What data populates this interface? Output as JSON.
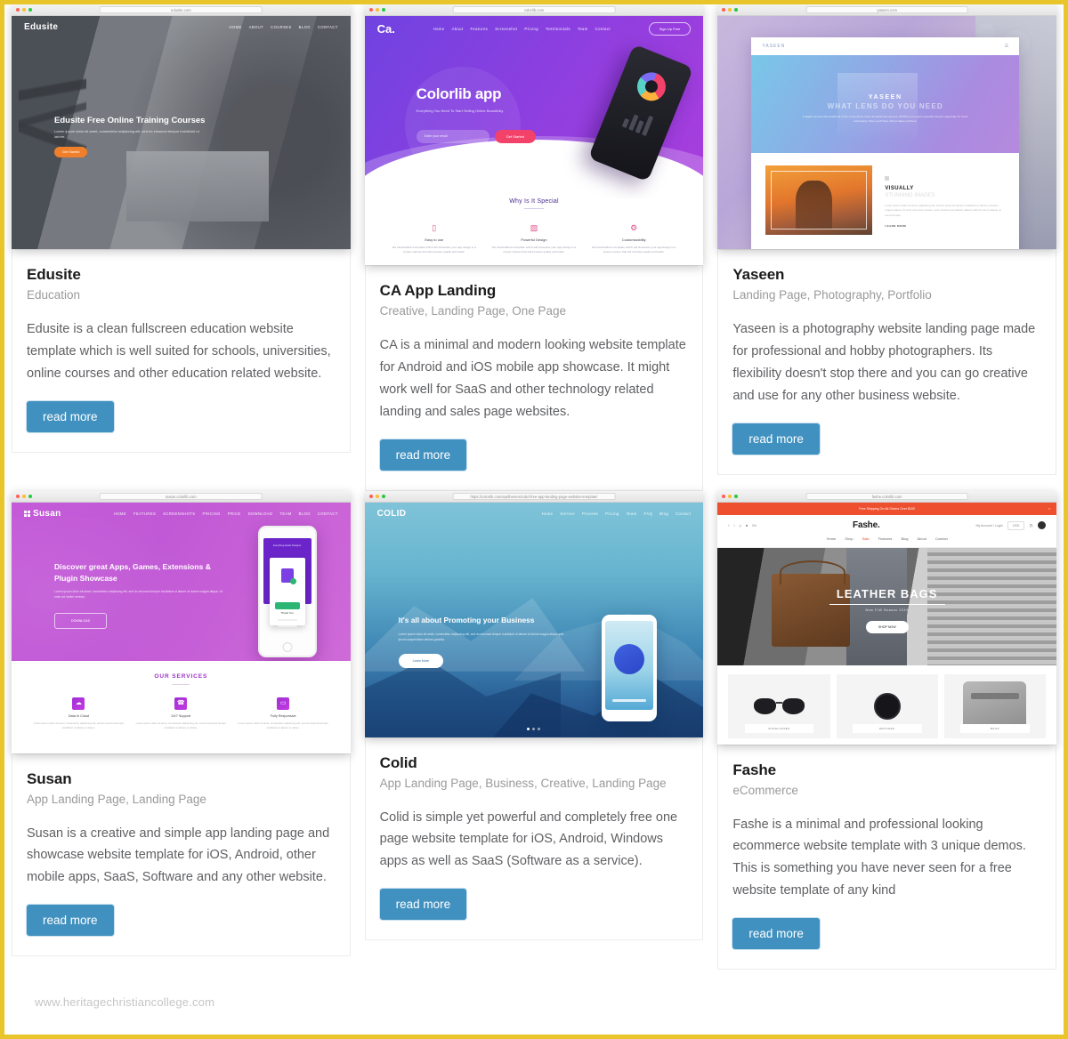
{
  "theme": {
    "page_border_color": "#e8c52a",
    "button_color": "#4191c0",
    "title_color": "#1b1b1b",
    "category_color": "#9a9a9a",
    "description_color": "#5f6063"
  },
  "watermark": "www.heritagechristiancollege.com",
  "cards": [
    {
      "title": "Edusite",
      "categories": "Education",
      "description": "Edusite is a clean fullscreen education website template which is well suited for schools, universities, online courses and other education related website.",
      "button_label": "read more",
      "preview": {
        "url": "edusite.com",
        "logo": "Edusite",
        "nav": [
          "HOME",
          "ABOUT",
          "COURSES",
          "BLOG",
          "CONTACT"
        ],
        "hero_title": "Edusite Free Online Training Courses",
        "hero_sub": "Lorem ipsum dolor sit amet, consectetur adipiscing elit, sed do eiusmod tempor incididunt ut labore.",
        "cta": "Get Started"
      }
    },
    {
      "title": "CA App Landing",
      "categories": "Creative, Landing Page, One Page",
      "description": "CA is a minimal and modern looking website template for Android and iOS mobile app showcase. It might work well for SaaS and other technology related landing and sales page websites.",
      "button_label": "read more",
      "preview": {
        "url": "colorlib.com",
        "logo": "Ca.",
        "nav": [
          "Home",
          "About",
          "Features",
          "Screenshot",
          "Pricing",
          "Testimonials",
          "Team",
          "Contact"
        ],
        "signup_label": "Sign Up Free",
        "hero_title": "Colorlib app",
        "hero_sub": "Everything You Need To Start Selling Online Beautifully.",
        "email_placeholder": "Enter your email",
        "cta": "Get Started",
        "section_title": "Why Is It Special",
        "features": [
          {
            "icon": "mobile-icon",
            "glyph": "▯",
            "title": "Easy to use",
            "text": "We handcrafted a template which will showcase your app design in a proper manner that will increase quality and leads."
          },
          {
            "icon": "layers-icon",
            "glyph": "▧",
            "title": "Powerful Design",
            "text": "We handcrafted a template which will showcase your app design in a proper manner that will increase quality and leads."
          },
          {
            "icon": "gear-icon",
            "glyph": "⚙",
            "title": "Customizability",
            "text": "We handcrafted a template which will showcase your app design in a proper manner that will increase quality and leads."
          }
        ]
      }
    },
    {
      "title": "Yaseen",
      "categories": "Landing Page, Photography, Portfolio",
      "description": "Yaseen is a photography website landing page made for professional and hobby photographers. Its flexibility doesn't stop there and you can go creative and use for any other business website.",
      "button_label": "read more",
      "preview": {
        "url": "yaseen.com",
        "logo": "YASEEN",
        "menu_icon": "hamburger-icon",
        "banner_title": "YASEEN",
        "banner_subtitle": "WHAT LENS DO YOU NEED",
        "banner_text": "A digital camera that breaks all of the conventions of an old fashioned camera. Whether you need a specific camera especially for focus and beauty, there you'll have what it takes out there.",
        "section_title": "VISUALLY",
        "section_subtitle": "STUNNING IMAGES",
        "section_text": "Lorem ipsum dolor sit amet, adipiscing elit, sed do eiusmod tempor incididunt ut labore et dolore magna aliqua. Ut enim ad minim veniam, quis nostrud exercitation ullamco laboris nisi ut aliquip ex ea commodo.",
        "read_more": "LEARN MORE"
      }
    },
    {
      "title": "Susan",
      "categories": "App Landing Page, Landing Page",
      "description": "Susan is a creative and simple app landing page and showcase website template for iOS, Android, other mobile apps, SaaS, Software and any other website.",
      "button_label": "read more",
      "preview": {
        "url": "susan.colorlib.com",
        "logo": "Susan",
        "nav": [
          "HOME",
          "FEATURES",
          "SCREENSHOTS",
          "PRICING",
          "PRICE",
          "DOWNLOAD",
          "TEAM",
          "BLOG",
          "CONTACT"
        ],
        "hero_title": "Discover great Apps, Games, Extensions & Plugin Showcase",
        "hero_sub": "Lorem ipsum dolor sit amet, consectetur adipiscing elit, sed do eiusmod tempor incididunt ut labore et dolore magna aliqua. Ut enim ad minim veniam.",
        "download_label": "DOWNLOAD",
        "phone_headline": "Everything Awaits Designer",
        "phone_thanks": "Thank You",
        "phone_note": "Your order has been placed successfully",
        "phone_cta": "CONTINUE SHOPPING",
        "section_title": "OUR SERVICES",
        "features": [
          {
            "icon": "cloud-icon",
            "glyph": "☁",
            "title": "Data In Cloud",
            "text": "Lorem ipsum dolor sit amet, consectetur adipiscing elit, sed do eiusmod tempor incididunt ut labore et dolore."
          },
          {
            "icon": "support-icon",
            "glyph": "☎",
            "title": "24/7 Support",
            "text": "Lorem ipsum dolor sit amet, consectetur adipiscing elit, sed do eiusmod tempor incididunt ut labore et dolore."
          },
          {
            "icon": "responsive-icon",
            "glyph": "▭",
            "title": "Fully Responsive",
            "text": "Lorem ipsum dolor sit amet, consectetur adipiscing elit, sed do eiusmod tempor incididunt ut labore et dolore."
          }
        ]
      }
    },
    {
      "title": "Colid",
      "categories": "App Landing Page, Business, Creative, Landing Page",
      "description": "Colid is simple yet powerful and completely free one page website template for iOS, Android, Windows apps as well as SaaS (Software as a service).",
      "button_label": "read more",
      "preview": {
        "url": "https://colorlib.com/wp/themes/colid-free-app-landing-page-website-template/",
        "logo": "COLID",
        "nav": [
          "Home",
          "Service",
          "Process",
          "Pricing",
          "Team",
          "FAQ",
          "Blog",
          "Contact"
        ],
        "hero_title": "It's all about Promoting your Business",
        "hero_sub": "Lorem ipsum dolor sit amet, consectetur adipiscing elit, sed do eiusmod tempor incididunt ut labore et dolore magna aliqua quis ipsum suspendisse ultrices gravida.",
        "cta": "Learn More"
      }
    },
    {
      "title": "Fashe",
      "categories": "eCommerce",
      "description": "Fashe is a minimal and professional looking ecommerce website template with 3 unique demos. This is something you have never seen for a free website template of any kind",
      "button_label": "read more",
      "preview": {
        "url": "fashe.colorlib.com",
        "promo_text": "Free Shipping On All Orders Over $100",
        "promo_close": "×",
        "brand": "Fashe.",
        "social_icons": [
          "facebook-icon",
          "twitter-icon",
          "pinterest-icon",
          "instagram-icon",
          "behance-icon"
        ],
        "account_label": "My Account / Login",
        "currency": "USD",
        "nav": [
          "Home",
          "Shop",
          "Sale",
          "Features",
          "Blog",
          "About",
          "Contact"
        ],
        "nav_active": "Sale",
        "hero_title": "LEATHER BAGS",
        "hero_sub": "New F/W Season 2019",
        "hero_cta": "SHOP NOW",
        "products": [
          {
            "label": "SUNGLASSES",
            "icon": "sunglasses-icon"
          },
          {
            "label": "WATCHES",
            "icon": "watch-icon"
          },
          {
            "label": "BAGS",
            "icon": "backpack-icon"
          }
        ]
      }
    }
  ]
}
